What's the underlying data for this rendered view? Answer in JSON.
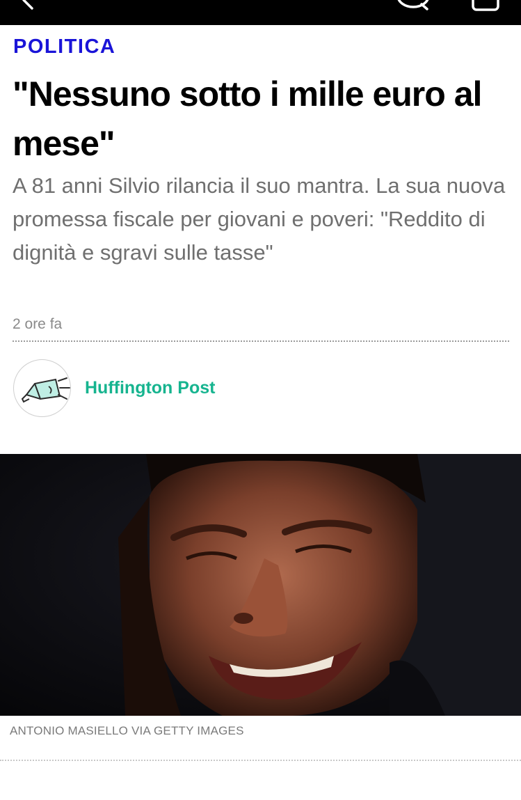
{
  "article": {
    "section": "POLITICA",
    "headline": "\"Nessuno sotto i mille euro al mese\"",
    "subtitle": "A 81 anni Silvio rilancia il suo mantra. La sua nuova promessa fiscale per giovani e poveri: \"Reddito di dignità e sgravi sulle tasse\"",
    "timestamp": "2 ore fa",
    "publisher": "Huffington Post",
    "photo_credit": "ANTONIO MASIELLO VIA GETTY IMAGES"
  },
  "icons": {
    "back": "chevron-left-icon",
    "comment": "speech-bubble-icon",
    "share": "share-box-icon",
    "publisher_logo": "megaphone-icon"
  },
  "colors": {
    "topbar": "#000000",
    "section": "#1a14d8",
    "publisher": "#16b48f",
    "subtitle": "#6f6f6f"
  }
}
